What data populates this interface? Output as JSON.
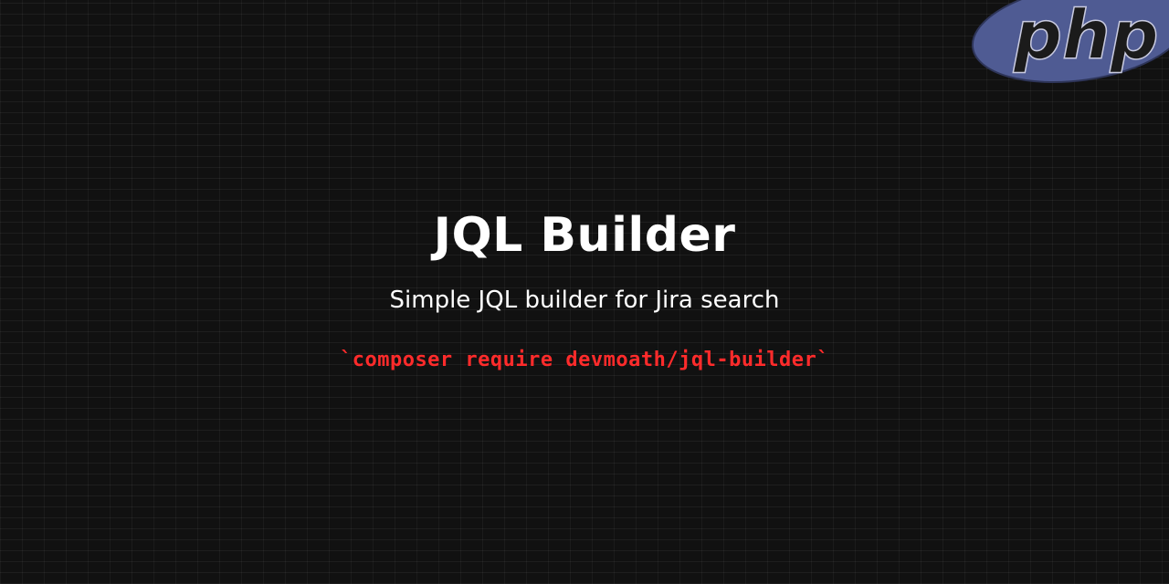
{
  "logo": {
    "text": "php",
    "icon": "php-logo",
    "colors": {
      "ellipse": "#4f5b93",
      "text": "#1b1b1b"
    }
  },
  "heading": {
    "title": "JQL Builder",
    "subtitle": "Simple JQL builder for Jira search",
    "install_command": "`composer require devmoath/jql-builder`"
  },
  "colors": {
    "background": "#111111",
    "title": "#ffffff",
    "command": "#ff2b2b"
  }
}
